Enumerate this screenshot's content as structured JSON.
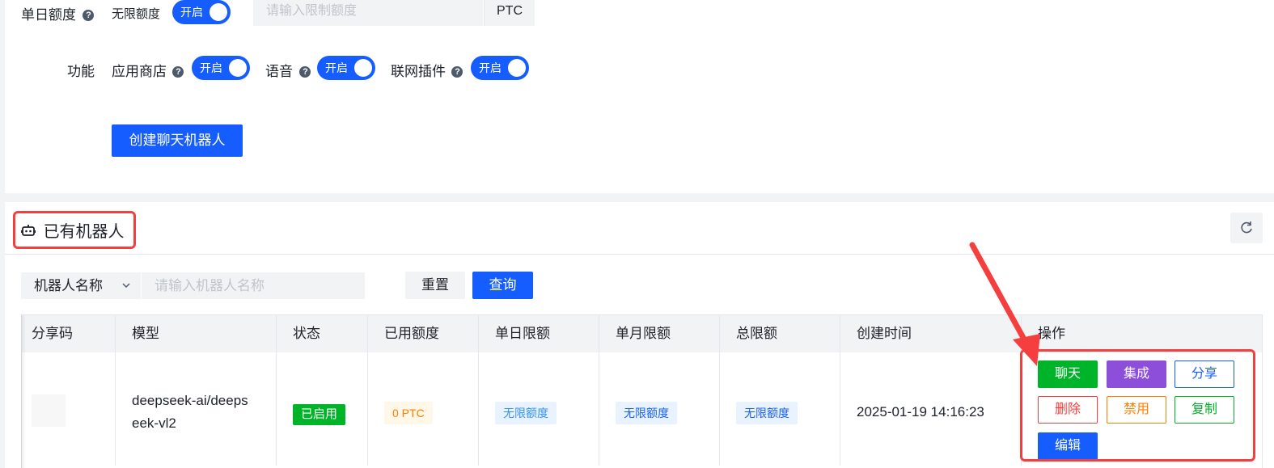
{
  "form": {
    "daily_quota_label": "单日额度",
    "help_mark": "?",
    "unlimited_label": "无限额度",
    "switch_on": "开启",
    "quota_placeholder": "请输入限制额度",
    "currency": "PTC",
    "features_label": "功能",
    "feature_app_store": "应用商店",
    "feature_voice": "语音",
    "feature_web_plugin": "联网插件",
    "create_button": "创建聊天机器人"
  },
  "robots": {
    "title": "已有机器人",
    "refresh_icon": "refresh-icon",
    "robot_icon": "robot-icon",
    "filter": {
      "field_select": "机器人名称",
      "name_placeholder": "请输入机器人名称",
      "reset": "重置",
      "query": "查询"
    },
    "table": {
      "headers": [
        "分享码",
        "模型",
        "状态",
        "已用额度",
        "单日限额",
        "单月限额",
        "总限额",
        "创建时间",
        "操作"
      ],
      "row": {
        "share_code": "",
        "model_line1": "deepseek-ai/deeps",
        "model_line2": "eek-vl2",
        "status": "已启用",
        "used_quota": "0 PTC",
        "daily_limit": "无限额度",
        "monthly_limit": "无限额度",
        "total_limit": "无限额度",
        "created_at": "2025-01-19 14:16:23"
      },
      "actions": {
        "chat": "聊天",
        "integrate": "集成",
        "share": "分享",
        "delete": "删除",
        "disable": "禁用",
        "copy": "复制",
        "edit": "编辑"
      }
    }
  },
  "colors": {
    "primary": "#165dff",
    "success": "#00b42a",
    "purple": "#8d4eda",
    "danger": "#f53f3f",
    "warning": "#ff7d00",
    "annotation": "#f53f3f"
  }
}
